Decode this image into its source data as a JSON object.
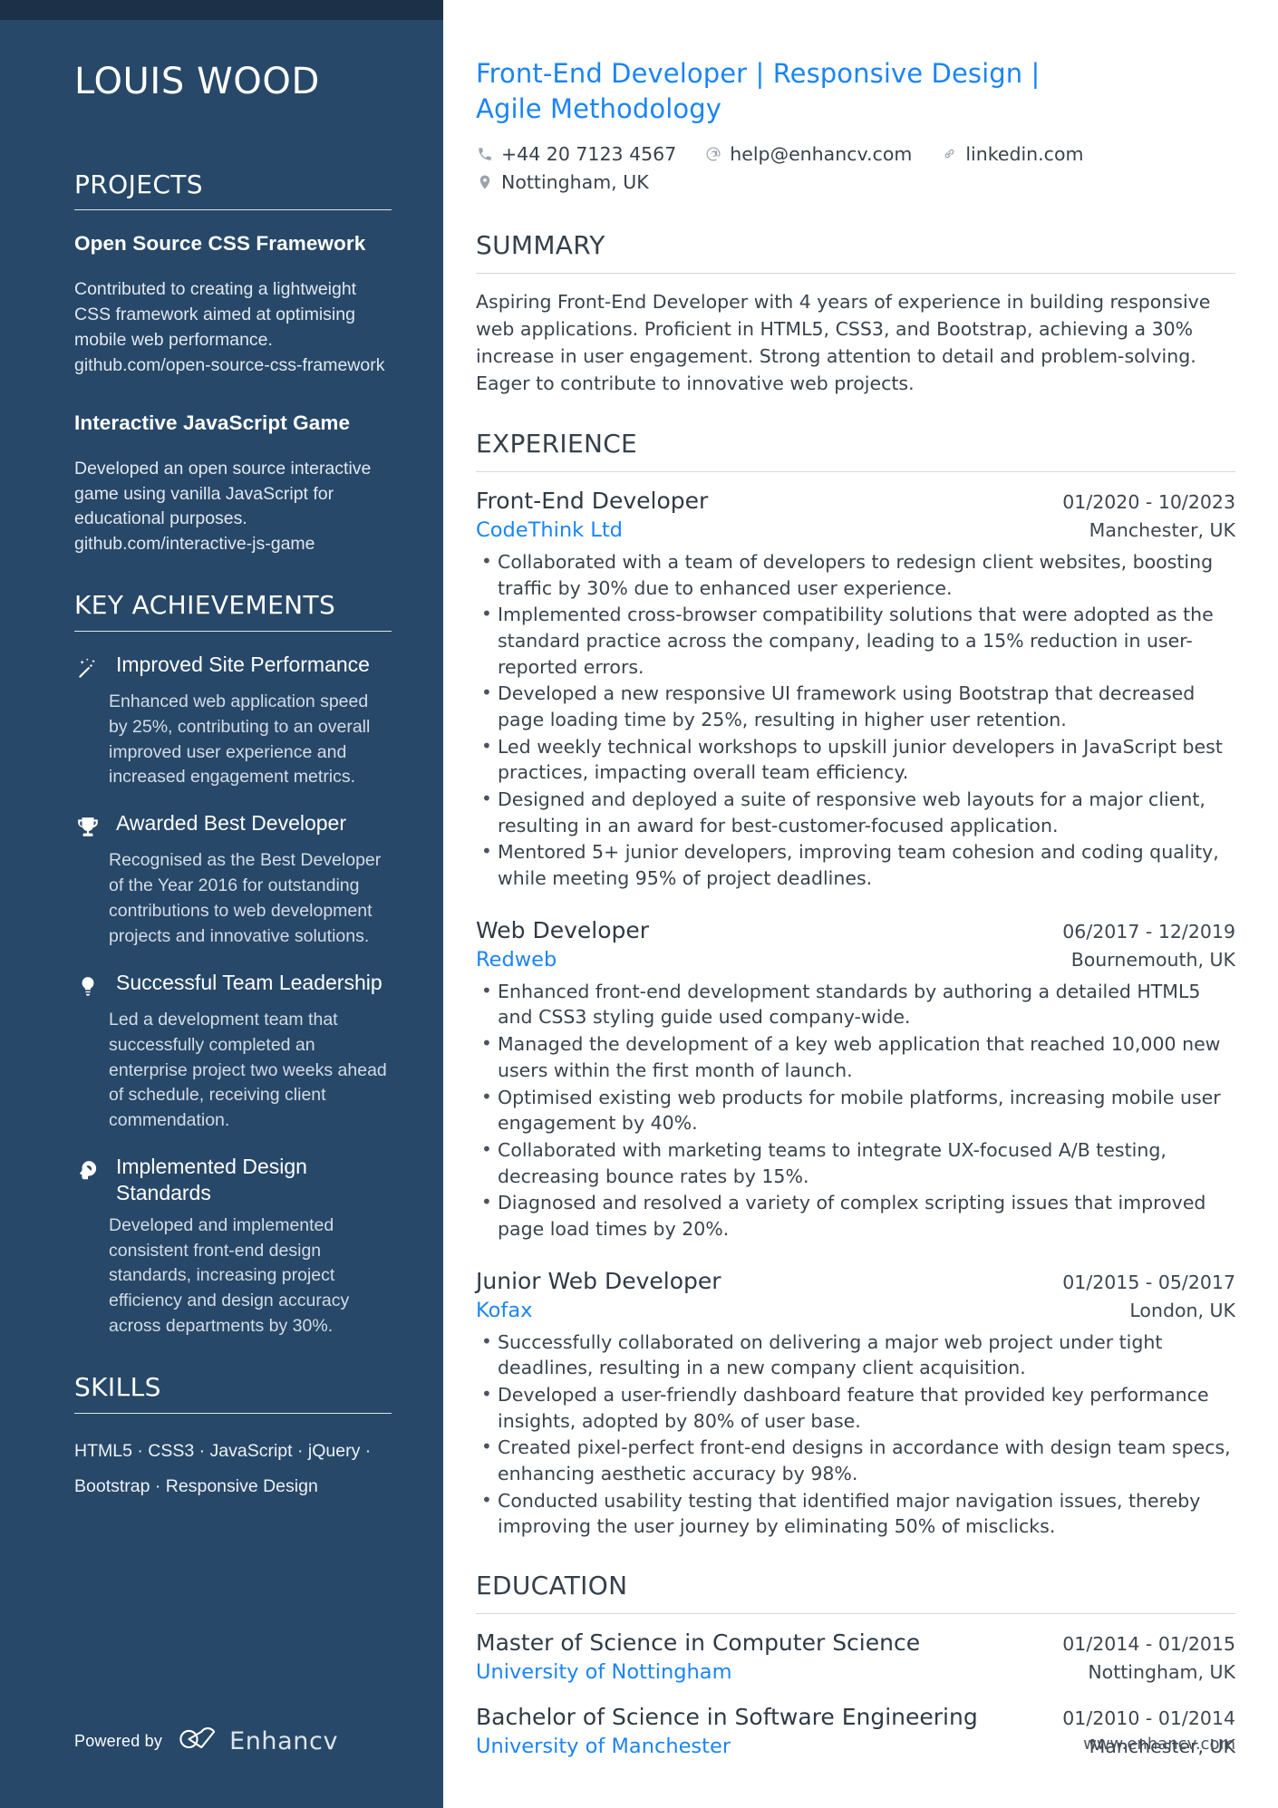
{
  "sidebar": {
    "name": "LOUIS WOOD",
    "projects": {
      "title": "PROJECTS",
      "items": [
        {
          "name": "Open Source CSS Framework",
          "description": "Contributed to creating a lightweight CSS framework aimed at optimising mobile web performance. github.com/open-source-css-framework"
        },
        {
          "name": "Interactive JavaScript Game",
          "description": "Developed an open source interactive game using vanilla JavaScript for educational purposes. github.com/interactive-js-game"
        }
      ]
    },
    "key_achievements": {
      "title": "KEY ACHIEVEMENTS",
      "items": [
        {
          "icon": "magic-wand-icon",
          "title": "Improved Site Performance",
          "description": "Enhanced web application speed by 25%, contributing to an overall improved user experience and increased engagement metrics."
        },
        {
          "icon": "trophy-icon",
          "title": "Awarded Best Developer",
          "description": "Recognised as the Best Developer of the Year 2016 for outstanding contributions to web development projects and innovative solutions."
        },
        {
          "icon": "lightbulb-icon",
          "title": "Successful Team Leadership",
          "description": "Led a development team that successfully completed an enterprise project two weeks ahead of schedule, receiving client commendation."
        },
        {
          "icon": "head-idea-icon",
          "title": "Implemented Design Standards",
          "description": "Developed and implemented consistent front-end design standards, increasing project efficiency and design accuracy across departments by 30%."
        }
      ]
    },
    "skills": {
      "title": "SKILLS",
      "line1": "HTML5 · CSS3 · JavaScript · jQuery ·",
      "line2": "Bootstrap · Responsive Design"
    },
    "powered_by": {
      "label": "Powered by",
      "brand": "Enhancv"
    }
  },
  "header": {
    "headline": "Front-End Developer | Responsive Design | Agile Methodology",
    "contacts": [
      {
        "icon": "phone-icon",
        "text": "+44 20 7123 4567"
      },
      {
        "icon": "at-email-icon",
        "text": "help@enhancv.com"
      },
      {
        "icon": "link-icon",
        "text": "linkedin.com"
      }
    ],
    "location": {
      "icon": "location-pin-icon",
      "text": "Nottingham, UK"
    }
  },
  "summary": {
    "title": "SUMMARY",
    "text": "Aspiring Front-End Developer with 4 years of experience in building responsive web applications. Proficient in HTML5, CSS3, and Bootstrap, achieving a 30% increase in user engagement. Strong attention to detail and problem-solving. Eager to contribute to innovative web projects."
  },
  "experience": {
    "title": "EXPERIENCE",
    "jobs": [
      {
        "title": "Front-End Developer",
        "dates": "01/2020 - 10/2023",
        "company": "CodeThink Ltd",
        "location": "Manchester, UK",
        "bullets": [
          "Collaborated with a team of developers to redesign client websites, boosting traffic by 30% due to enhanced user experience.",
          "Implemented cross-browser compatibility solutions that were adopted as the standard practice across the company, leading to a 15% reduction in user-reported errors.",
          "Developed a new responsive UI framework using Bootstrap that decreased page loading time by 25%, resulting in higher user retention.",
          "Led weekly technical workshops to upskill junior developers in JavaScript best practices, impacting overall team efficiency.",
          "Designed and deployed a suite of responsive web layouts for a major client, resulting in an award for best-customer-focused application.",
          "Mentored 5+ junior developers, improving team cohesion and coding quality, while meeting 95% of project deadlines."
        ]
      },
      {
        "title": "Web Developer",
        "dates": "06/2017 - 12/2019",
        "company": "Redweb",
        "location": "Bournemouth, UK",
        "bullets": [
          "Enhanced front-end development standards by authoring a detailed HTML5 and CSS3 styling guide used company-wide.",
          "Managed the development of a key web application that reached 10,000 new users within the first month of launch.",
          "Optimised existing web products for mobile platforms, increasing mobile user engagement by 40%.",
          "Collaborated with marketing teams to integrate UX-focused A/B testing, decreasing bounce rates by 15%.",
          "Diagnosed and resolved a variety of complex scripting issues that improved page load times by 20%."
        ]
      },
      {
        "title": "Junior Web Developer",
        "dates": "01/2015 - 05/2017",
        "company": "Kofax",
        "location": "London, UK",
        "bullets": [
          "Successfully collaborated on delivering a major web project under tight deadlines, resulting in a new company client acquisition.",
          "Developed a user-friendly dashboard feature that provided key performance insights, adopted by 80% of user base.",
          "Created pixel-perfect front-end designs in accordance with design team specs, enhancing aesthetic accuracy by 98%.",
          "Conducted usability testing that identified major navigation issues, thereby improving the user journey by eliminating 50% of misclicks."
        ]
      }
    ]
  },
  "education": {
    "title": "EDUCATION",
    "items": [
      {
        "degree": "Master of Science in Computer Science",
        "dates": "01/2014 - 01/2015",
        "school": "University of Nottingham",
        "location": "Nottingham, UK"
      },
      {
        "degree": "Bachelor of Science in Software Engineering",
        "dates": "01/2010 - 01/2014",
        "school": "University of Manchester",
        "location": "Manchester, UK"
      }
    ]
  },
  "footer": {
    "website": "www.enhancv.com"
  },
  "colors": {
    "sidebar_bg": "#274868",
    "sidebar_top_strip": "#1c3148",
    "accent_blue": "#1b85f3",
    "text_dark": "#35404b"
  }
}
